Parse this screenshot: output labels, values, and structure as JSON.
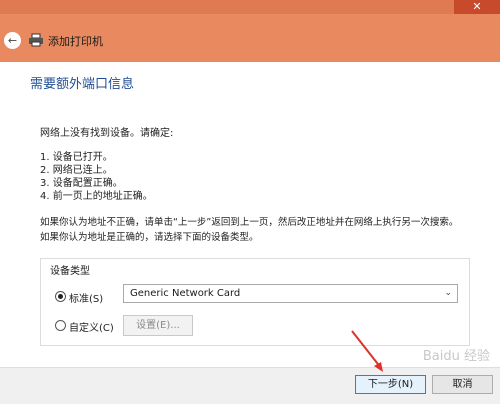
{
  "window": {
    "title": "添加打印机",
    "close_glyph": "✕",
    "back_glyph": "←"
  },
  "page_title": "需要额外端口信息",
  "intro": "网络上没有找到设备。请确定:",
  "checklist": [
    "1.  设备已打开。",
    "2.  网络已连上。",
    "3.  设备配置正确。",
    "4.  前一页上的地址正确。"
  ],
  "note_lines": [
    "如果你认为地址不正确，请单击“上一步”返回到上一页，然后改正地址并在网络上执行另一次搜索。",
    "如果你认为地址是正确的，请选择下面的设备类型。"
  ],
  "device_type": {
    "legend": "设备类型",
    "standard_label": "标准(S)",
    "standard_selected": true,
    "standard_value": "Generic Network Card",
    "custom_label": "自定义(C)",
    "settings_label": "设置(E)..."
  },
  "footer": {
    "next_label": "下一步(N)",
    "cancel_label": "取消"
  },
  "colors": {
    "titlebar": "#e9895f",
    "close": "#c84a2c",
    "heading": "#1f4e93",
    "annotation_arrow": "#e0302a"
  },
  "watermark": "Baidu 经验"
}
